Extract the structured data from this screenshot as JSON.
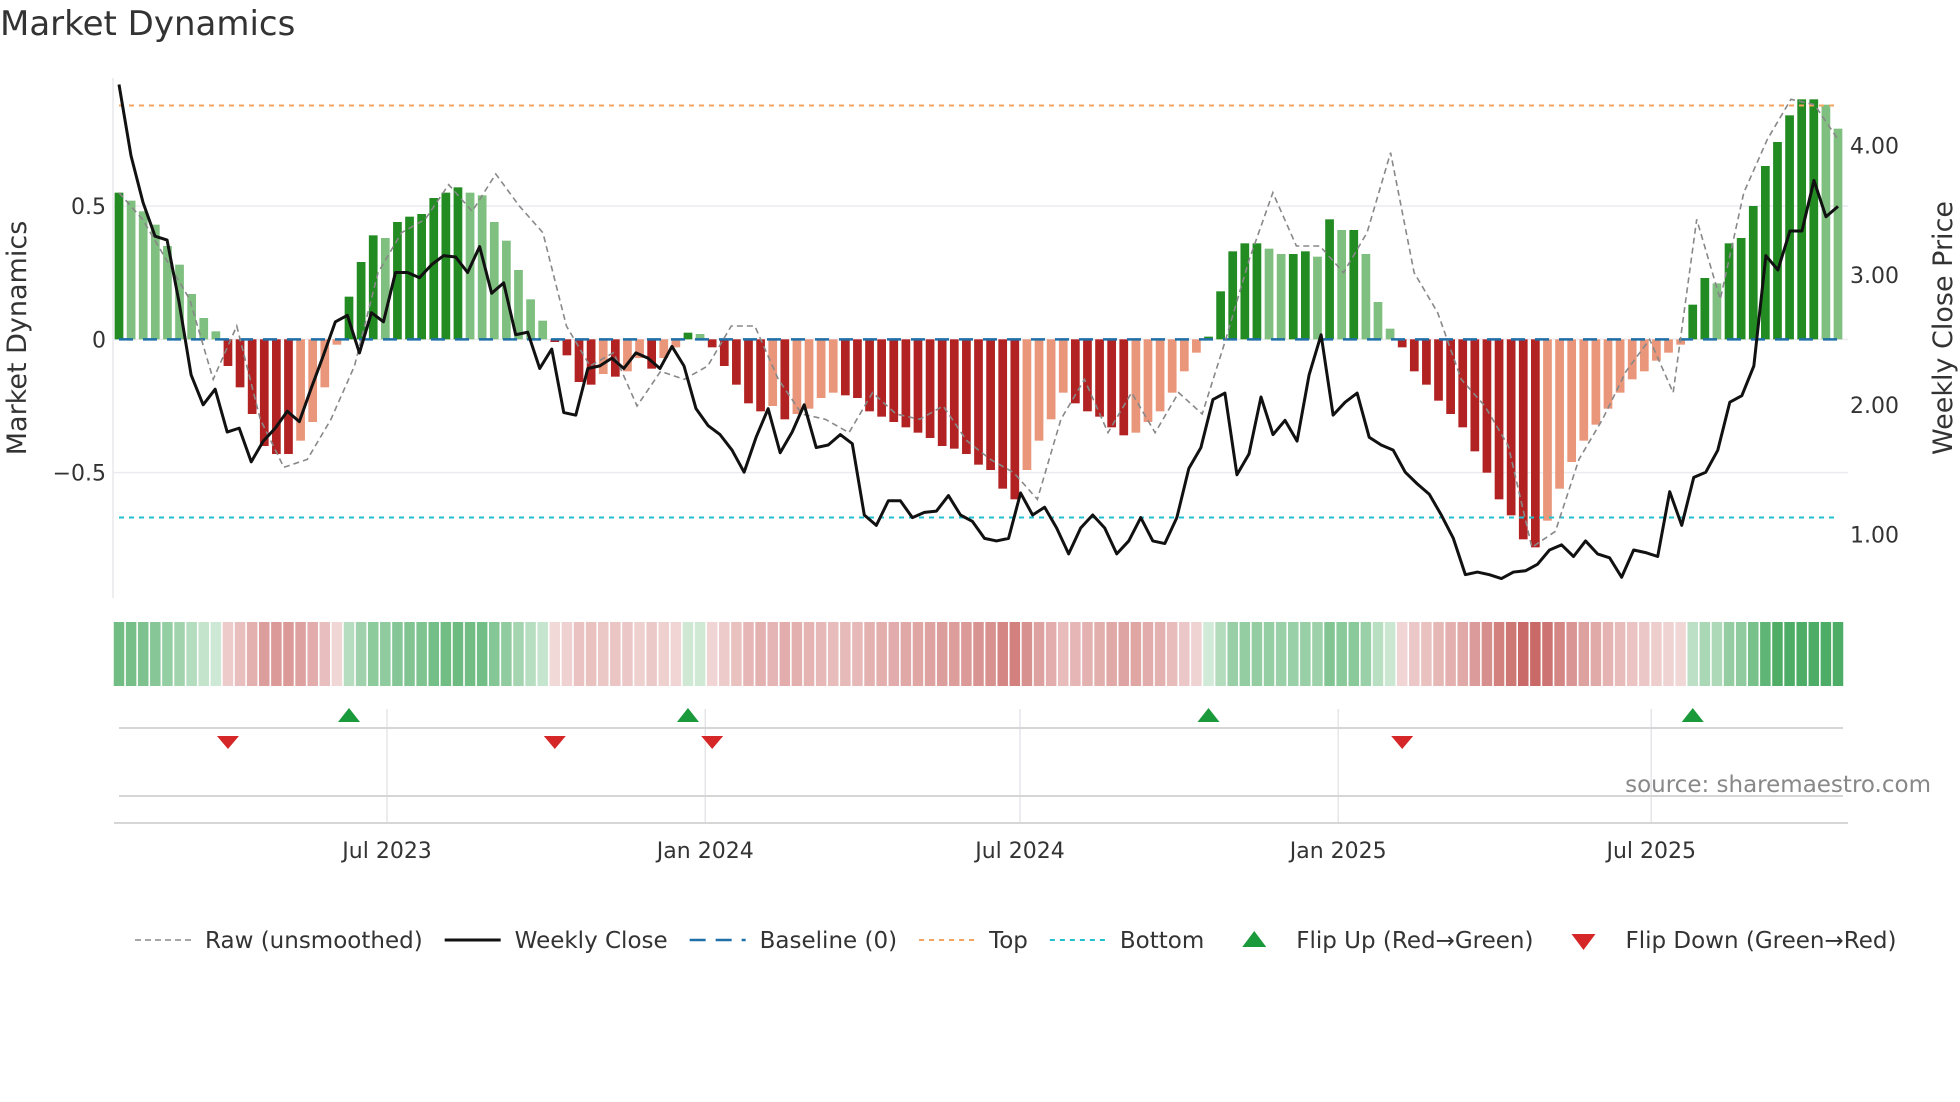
{
  "title": "Market Dynamics",
  "source": "source: sharemaestro.com",
  "colors": {
    "pos_rising": "#228b22",
    "pos_falling": "#7fbf7f",
    "neg_falling": "#b22222",
    "neg_rising": "#e9967a",
    "price": "#111111",
    "raw": "#888888",
    "baseline": "#1f6fa8",
    "top": "#f4a460",
    "bottom": "#20c0d0",
    "flip_up": "#1a9a3a",
    "flip_down": "#d62728"
  },
  "chart_data": {
    "type": "bar",
    "title": "Market Dynamics",
    "ylabel": "Market Dynamics",
    "y2label": "Weekly Close Price",
    "ylim": [
      -0.97,
      0.98
    ],
    "y2lim": [
      0.51,
      4.52
    ],
    "yticks": [
      {
        "v": 0.5,
        "label": "0.5"
      },
      {
        "v": 0,
        "label": "0"
      },
      {
        "v": -0.5,
        "label": "−0.5"
      }
    ],
    "y2ticks": [
      {
        "v": 4,
        "label": "4.00"
      },
      {
        "v": 3,
        "label": "3.00"
      },
      {
        "v": 2,
        "label": "2.00"
      },
      {
        "v": 1,
        "label": "1.00"
      }
    ],
    "start_date": "2023-01-27",
    "frequency": "weekly",
    "xticks": [
      {
        "date": "2023-07-01",
        "label": "Jul 2023"
      },
      {
        "date": "2024-01-01",
        "label": "Jan 2024"
      },
      {
        "date": "2024-07-01",
        "label": "Jul 2024"
      },
      {
        "date": "2025-01-01",
        "label": "Jan 2025"
      },
      {
        "date": "2025-07-01",
        "label": "Jul 2025"
      }
    ],
    "top": 0.877,
    "bottom": -0.668,
    "baseline": 0,
    "dynamics": [
      0.55,
      0.52,
      0.48,
      0.43,
      0.35,
      0.28,
      0.17,
      0.08,
      0.03,
      -0.1,
      -0.18,
      -0.28,
      -0.4,
      -0.43,
      -0.43,
      -0.38,
      -0.31,
      -0.18,
      -0.02,
      0.16,
      0.29,
      0.39,
      0.38,
      0.44,
      0.46,
      0.47,
      0.53,
      0.55,
      0.57,
      0.55,
      0.54,
      0.44,
      0.37,
      0.26,
      0.15,
      0.07,
      -0.01,
      -0.06,
      -0.16,
      -0.17,
      -0.13,
      -0.14,
      -0.12,
      -0.07,
      -0.11,
      -0.07,
      -0.03,
      0.025,
      0.02,
      -0.03,
      -0.1,
      -0.17,
      -0.24,
      -0.27,
      -0.25,
      -0.3,
      -0.28,
      -0.26,
      -0.22,
      -0.2,
      -0.21,
      -0.22,
      -0.27,
      -0.29,
      -0.31,
      -0.33,
      -0.35,
      -0.37,
      -0.4,
      -0.41,
      -0.43,
      -0.47,
      -0.49,
      -0.56,
      -0.6,
      -0.49,
      -0.38,
      -0.3,
      -0.2,
      -0.24,
      -0.27,
      -0.29,
      -0.33,
      -0.36,
      -0.35,
      -0.31,
      -0.27,
      -0.2,
      -0.12,
      -0.05,
      0.01,
      0.18,
      0.33,
      0.36,
      0.36,
      0.34,
      0.32,
      0.32,
      0.33,
      0.31,
      0.45,
      0.41,
      0.41,
      0.32,
      0.14,
      0.04,
      -0.03,
      -0.12,
      -0.17,
      -0.23,
      -0.28,
      -0.33,
      -0.42,
      -0.5,
      -0.6,
      -0.66,
      -0.75,
      -0.78,
      -0.68,
      -0.56,
      -0.46,
      -0.38,
      -0.32,
      -0.26,
      -0.2,
      -0.15,
      -0.12,
      -0.08,
      -0.05,
      -0.02,
      0.13,
      0.23,
      0.21,
      0.36,
      0.38,
      0.5,
      0.65,
      0.74,
      0.84,
      0.9,
      0.9,
      0.88,
      0.79
    ],
    "raw": [
      0.55,
      0.45,
      0.3,
      0.15,
      -0.15,
      0.05,
      -0.3,
      -0.48,
      -0.45,
      -0.3,
      -0.1,
      0.25,
      0.4,
      0.45,
      0.58,
      0.48,
      0.62,
      0.5,
      0.4,
      0.05,
      -0.1,
      -0.05,
      -0.25,
      -0.12,
      -0.15,
      -0.1,
      0.05,
      0.05,
      -0.15,
      -0.28,
      -0.3,
      -0.35,
      -0.2,
      -0.28,
      -0.3,
      -0.25,
      -0.38,
      -0.45,
      -0.5,
      -0.6,
      -0.3,
      -0.15,
      -0.35,
      -0.2,
      -0.35,
      -0.2,
      -0.28,
      0.0,
      0.3,
      0.55,
      0.35,
      0.35,
      0.25,
      0.4,
      0.7,
      0.25,
      0.1,
      -0.15,
      -0.25,
      -0.4,
      -0.78,
      -0.72,
      -0.45,
      -0.3,
      -0.12,
      0.0,
      -0.2,
      0.45,
      0.15,
      0.55,
      0.75,
      0.9,
      0.88,
      0.75
    ],
    "price": [
      4.47,
      3.92,
      3.56,
      3.3,
      3.27,
      2.79,
      2.23,
      2.0,
      2.12,
      1.79,
      1.82,
      1.56,
      1.72,
      1.82,
      1.95,
      1.87,
      2.13,
      2.38,
      2.64,
      2.69,
      2.4,
      2.71,
      2.64,
      3.02,
      3.02,
      2.98,
      3.08,
      3.15,
      3.14,
      3.02,
      3.22,
      2.86,
      2.94,
      2.54,
      2.56,
      2.28,
      2.43,
      1.94,
      1.92,
      2.28,
      2.3,
      2.36,
      2.28,
      2.4,
      2.36,
      2.28,
      2.45,
      2.3,
      1.97,
      1.84,
      1.77,
      1.65,
      1.48,
      1.75,
      1.97,
      1.63,
      1.79,
      2.0,
      1.67,
      1.69,
      1.77,
      1.7,
      1.15,
      1.07,
      1.26,
      1.26,
      1.13,
      1.17,
      1.18,
      1.3,
      1.15,
      1.1,
      0.97,
      0.95,
      0.97,
      1.32,
      1.15,
      1.21,
      1.05,
      0.85,
      1.05,
      1.15,
      1.05,
      0.85,
      0.95,
      1.13,
      0.95,
      0.93,
      1.13,
      1.51,
      1.67,
      2.04,
      2.09,
      1.46,
      1.62,
      2.06,
      1.77,
      1.88,
      1.72,
      2.23,
      2.54,
      1.92,
      2.02,
      2.09,
      1.75,
      1.69,
      1.65,
      1.48,
      1.39,
      1.31,
      1.15,
      0.97,
      0.69,
      0.71,
      0.69,
      0.66,
      0.71,
      0.72,
      0.77,
      0.88,
      0.92,
      0.83,
      0.95,
      0.85,
      0.82,
      0.67,
      0.88,
      0.86,
      0.83,
      1.33,
      1.07,
      1.44,
      1.48,
      1.65,
      2.02,
      2.07,
      2.3,
      3.15,
      3.04,
      3.34,
      3.34,
      3.73,
      3.45,
      3.53
    ],
    "flips_up": [
      19,
      47,
      90,
      130
    ],
    "flips_down": [
      9,
      36,
      49,
      106
    ],
    "legend": [
      {
        "key": "raw",
        "label": "Raw (unsmoothed)"
      },
      {
        "key": "price",
        "label": "Weekly Close"
      },
      {
        "key": "baseline",
        "label": "Baseline (0)"
      },
      {
        "key": "top",
        "label": "Top"
      },
      {
        "key": "bottom",
        "label": "Bottom"
      },
      {
        "key": "flip_up",
        "label": "Flip Up (Red→Green)"
      },
      {
        "key": "flip_down",
        "label": "Flip Down (Green→Red)"
      }
    ],
    "legend_position": "bottom"
  }
}
